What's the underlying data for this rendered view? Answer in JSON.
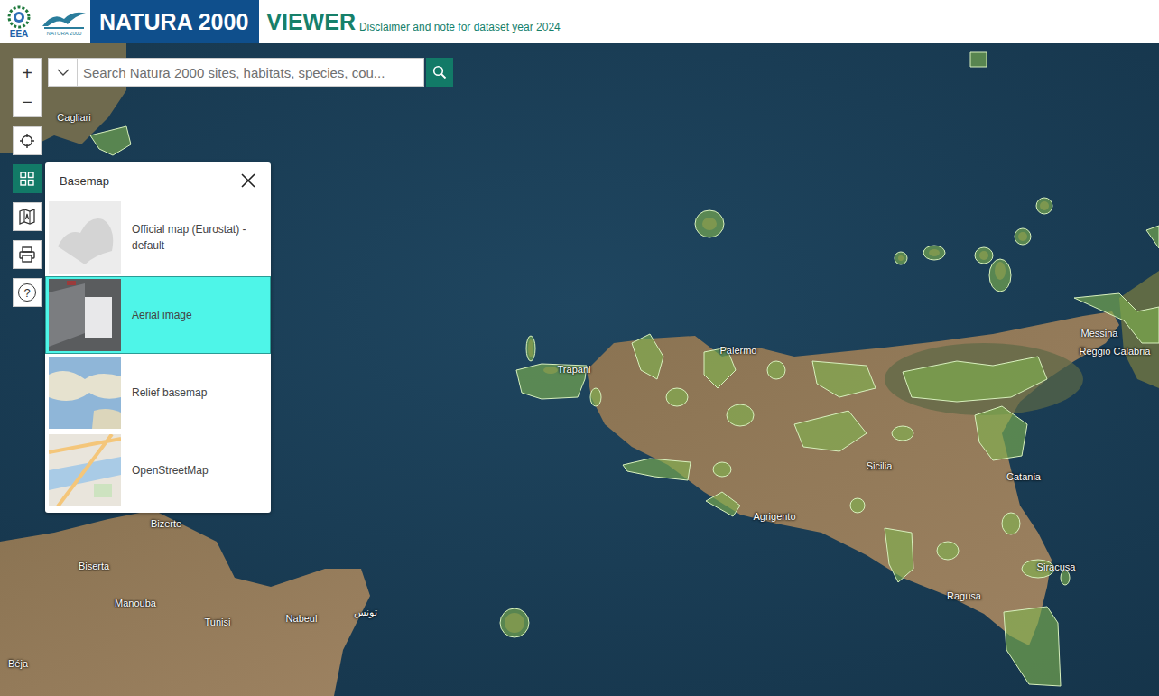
{
  "header": {
    "eea_logo_text": "EEA",
    "natura_logo_text": "NATURA 2000",
    "title": "NATURA 2000",
    "subtitle": "VIEWER",
    "note": "Disclaimer and note for dataset year 2024"
  },
  "search": {
    "placeholder": "Search Natura 2000 sites, habitats, species, cou..."
  },
  "map_controls": [
    {
      "kind": "zoom-in",
      "label": "+",
      "selected": false
    },
    {
      "kind": "zoom-out",
      "label": "−",
      "selected": false
    },
    {
      "kind": "locate",
      "label": "",
      "selected": false
    },
    {
      "kind": "basemap",
      "label": "",
      "selected": true
    },
    {
      "kind": "language",
      "label": "",
      "selected": false
    },
    {
      "kind": "print",
      "label": "",
      "selected": false
    },
    {
      "kind": "help",
      "label": "?",
      "selected": false
    }
  ],
  "basemap_panel": {
    "title": "Basemap",
    "options": [
      {
        "label": "Official map (Eurostat) - default",
        "kind": "official",
        "selected": false
      },
      {
        "label": "Aerial image",
        "kind": "aerial",
        "selected": true
      },
      {
        "label": "Relief basemap",
        "kind": "relief",
        "selected": false
      },
      {
        "label": "OpenStreetMap",
        "kind": "osm",
        "selected": false
      }
    ]
  },
  "map": {
    "labels": [
      {
        "text": "Cagliari"
      },
      {
        "text": "Trapani"
      },
      {
        "text": "Palermo"
      },
      {
        "text": "Messina"
      },
      {
        "text": "Reggio Calabria"
      },
      {
        "text": "Catania"
      },
      {
        "text": "Sicilia"
      },
      {
        "text": "Agrigento"
      },
      {
        "text": "Siracusa"
      },
      {
        "text": "Ragusa"
      },
      {
        "text": "Bizerte"
      },
      {
        "text": "Biserta"
      },
      {
        "text": "Manouba"
      },
      {
        "text": "Tunisi"
      },
      {
        "text": "تونس"
      },
      {
        "text": "Nabeul"
      },
      {
        "text": "Béja"
      }
    ]
  }
}
